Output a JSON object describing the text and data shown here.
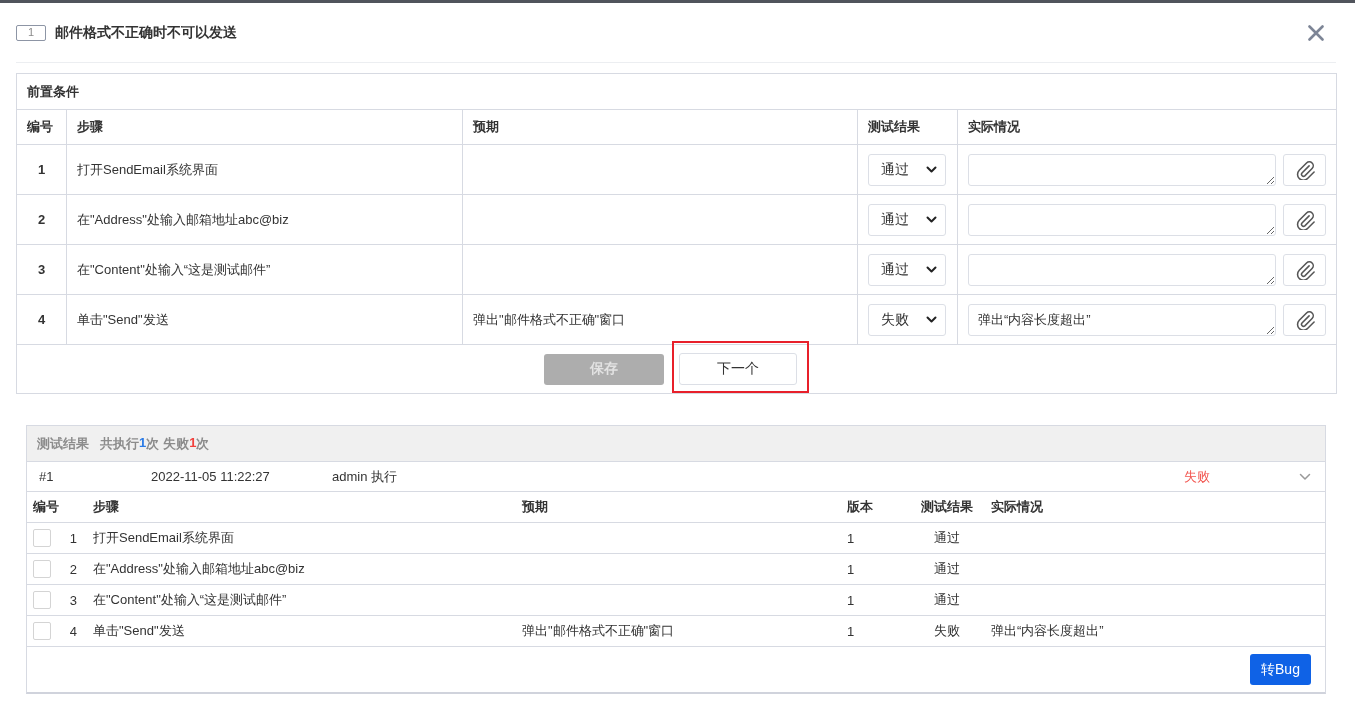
{
  "dialog": {
    "case_number": "1",
    "title": "邮件格式不正确时不可以发送"
  },
  "steps_table": {
    "caption": "前置条件",
    "columns": [
      "编号",
      "步骤",
      "预期",
      "测试结果",
      "实际情况"
    ],
    "rows": [
      {
        "number": "1",
        "step": "打开SendEmail系统界面",
        "result": "通过"
      },
      {
        "number": "2",
        "step": "在\"Address\"处输入邮箱地址abc@biz",
        "result": "通过"
      },
      {
        "number": "3",
        "step": "在\"Content\"处输入“这是测试邮件”",
        "result": "通过"
      },
      {
        "number": "4",
        "step": "单击\"Send\"发送",
        "expected": "弹出\"邮件格式不正确\"窗口",
        "result": "失败",
        "actual": "弹出“内容长度超出”"
      }
    ]
  },
  "actions": {
    "save": {
      "label": "保存",
      "disabled": true
    },
    "next": {
      "label": "下一个",
      "highlighted": true
    }
  },
  "results_panel": {
    "title": "测试结果",
    "stats": [
      {
        "label": "共执行",
        "count": "1",
        "unit": "次",
        "color": "#2b7be6"
      },
      {
        "label": "失败",
        "count": "1",
        "unit": "次",
        "color": "#f1403c"
      }
    ],
    "runs": [
      {
        "id": "#1",
        "time": "2022-11-05 11:22:27",
        "executor": "admin 执行",
        "result": "失败",
        "color": "#f2554f"
      }
    ],
    "columns": [
      "编号",
      "步骤",
      "预期",
      "版本",
      "测试结果",
      "实际情况"
    ],
    "rows": [
      {
        "checked": false,
        "number": "1",
        "step": "打开SendEmail系统界面",
        "version": "1",
        "result": "通过"
      },
      {
        "checked": false,
        "number": "2",
        "step": "在\"Address\"处输入邮箱地址abc@biz",
        "version": "1",
        "result": "通过"
      },
      {
        "checked": false,
        "number": "3",
        "step": "在\"Content\"处输入“这是测试邮件”",
        "version": "1",
        "result": "通过"
      },
      {
        "checked": false,
        "number": "4",
        "step": "单击\"Send\"发送",
        "expected": "弹出\"邮件格式不正确\"窗口",
        "version": "1",
        "result": "失败",
        "actual": "弹出“内容长度超出”"
      }
    ],
    "to_bug_button": "转Bug"
  }
}
